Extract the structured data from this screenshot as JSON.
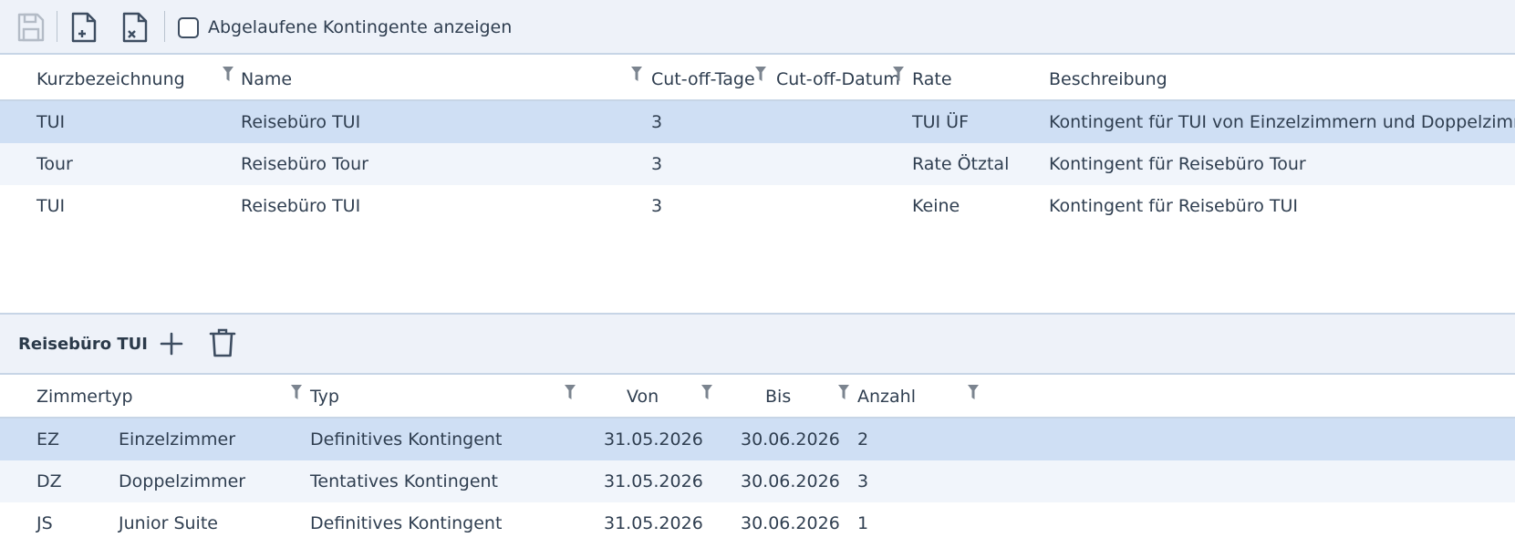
{
  "toolbar": {
    "save_icon": "save-icon",
    "new_icon": "file-add-icon",
    "delete_icon": "file-delete-icon",
    "checkbox_label": "Abgelaufene Kontingente anzeigen",
    "checkbox_checked": false
  },
  "upper_table": {
    "headers": [
      "Kurzbezeichnung",
      "Name",
      "Cut-off-Tage",
      "Cut-off-Datum",
      "Rate",
      "Beschreibung"
    ],
    "rows": [
      {
        "kurz": "TUI",
        "name": "Reisebüro TUI",
        "tage": "3",
        "datum": "",
        "rate": "TUI ÜF",
        "beschreibung": "Kontingent für TUI von Einzelzimmern und Doppelzimmern"
      },
      {
        "kurz": "Tour",
        "name": "Reisebüro Tour",
        "tage": "3",
        "datum": "",
        "rate": "Rate Ötztal",
        "beschreibung": "Kontingent für Reisebüro Tour"
      },
      {
        "kurz": "TUI",
        "name": "Reisebüro TUI",
        "tage": "3",
        "datum": "",
        "rate": "Keine",
        "beschreibung": "Kontingent für Reisebüro TUI"
      }
    ]
  },
  "detail": {
    "title": "Reisebüro TUI",
    "add_icon": "plus-icon",
    "delete_icon": "trash-icon"
  },
  "lower_table": {
    "headers": [
      "Zimmertyp",
      "Typ",
      "Von",
      "Bis",
      "Anzahl"
    ],
    "rows": [
      {
        "code": "EZ",
        "zimmer": "Einzelzimmer",
        "typ": "Definitives Kontingent",
        "von": "31.05.2026",
        "bis": "30.06.2026",
        "anzahl": "2"
      },
      {
        "code": "DZ",
        "zimmer": "Doppelzimmer",
        "typ": "Tentatives Kontingent",
        "von": "31.05.2026",
        "bis": "30.06.2026",
        "anzahl": "3"
      },
      {
        "code": "JS",
        "zimmer": "Junior Suite",
        "typ": "Definitives Kontingent",
        "von": "31.05.2026",
        "bis": "30.06.2026",
        "anzahl": "1"
      }
    ]
  },
  "colors": {
    "selected_row": "#cfdff4",
    "alt_row": "#f1f5fb",
    "toolbar_bg": "#eef2f9",
    "divider": "#c7d5e6"
  }
}
